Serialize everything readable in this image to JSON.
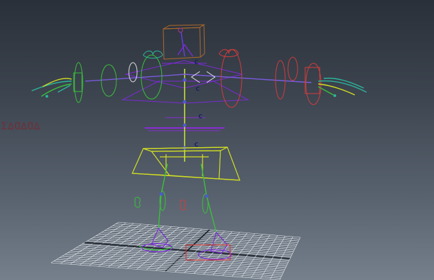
{
  "viewport": {
    "background_top": "#2a3039",
    "background_bottom": "#75808c",
    "grid_color": "#e6e9ee"
  },
  "rig": {
    "colors": {
      "center_controls": "#7b2bd6",
      "spine_yellow": "#d4e021",
      "left_side": "#39c23a",
      "right_side": "#d43c3c",
      "hands": "#2bb59c",
      "head_box": "#b06a2a",
      "joints": "#4b5bd0"
    },
    "pivot_labels": [
      "C",
      "C",
      "C",
      "C"
    ],
    "background_text": "Ʃ∆Ɑ∆Ɑ∆"
  }
}
